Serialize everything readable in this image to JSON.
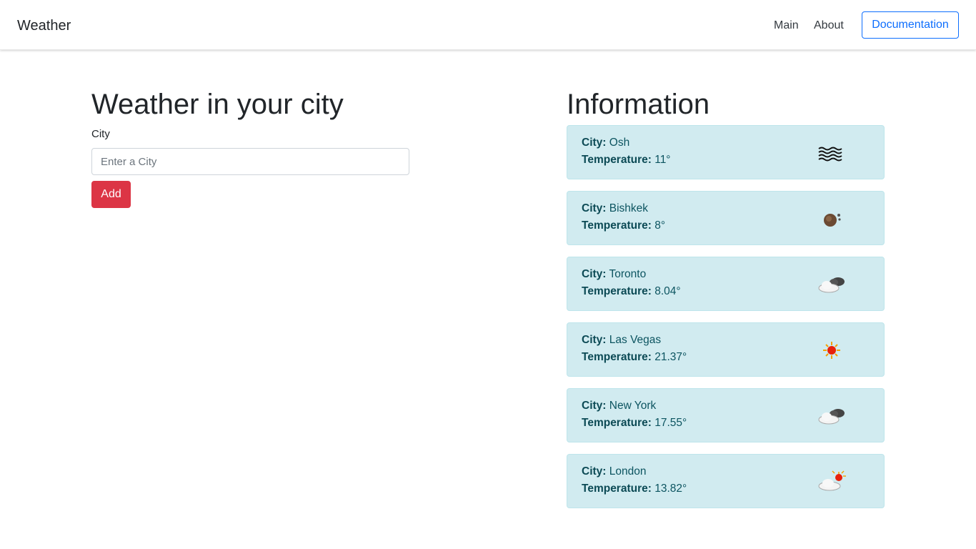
{
  "navbar": {
    "brand": "Weather",
    "links": [
      "Main",
      "About"
    ],
    "docs_button": "Documentation"
  },
  "form": {
    "title": "Weather in your city",
    "label": "City",
    "placeholder": "Enter a City",
    "value": "",
    "add_button": "Add"
  },
  "info": {
    "title": "Information",
    "city_label": "City:",
    "temp_label": "Temperature:",
    "cards": [
      {
        "city": "Osh",
        "temperature": "11°",
        "icon": "mist-icon"
      },
      {
        "city": "Bishkek",
        "temperature": "8°",
        "icon": "smoke-icon"
      },
      {
        "city": "Toronto",
        "temperature": "8.04°",
        "icon": "broken-clouds-icon"
      },
      {
        "city": "Las Vegas",
        "temperature": "21.37°",
        "icon": "clear-sky-icon"
      },
      {
        "city": "New York",
        "temperature": "17.55°",
        "icon": "broken-clouds-icon"
      },
      {
        "city": "London",
        "temperature": "13.82°",
        "icon": "few-clouds-icon"
      }
    ]
  },
  "colors": {
    "primary": "#0d6efd",
    "danger": "#dc3545",
    "card_bg": "#d1ebf0",
    "card_text": "#0c5460"
  }
}
